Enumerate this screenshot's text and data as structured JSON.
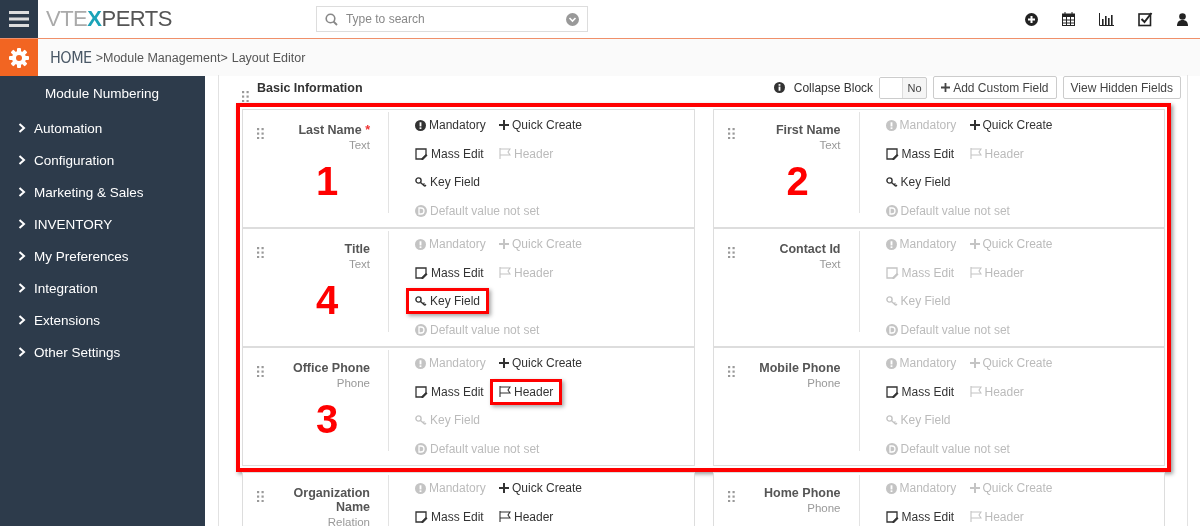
{
  "header": {
    "logo": {
      "lead": "VTE",
      "mark": "X",
      "tail": "PERTS"
    },
    "search": {
      "placeholder": "Type to search"
    }
  },
  "breadcrumb": [
    {
      "label": "HOME",
      "kind": "home"
    },
    {
      "label": ">Module Management>",
      "kind": "link"
    },
    {
      "label": "Layout Editor",
      "kind": "current"
    }
  ],
  "sidebar": {
    "items": [
      {
        "label": "Module Numbering",
        "kind": "subitem"
      },
      {
        "label": "Automation",
        "kind": "group",
        "expanded": false
      },
      {
        "label": "Configuration",
        "kind": "group",
        "expanded": false
      },
      {
        "label": "Marketing & Sales",
        "kind": "group",
        "expanded": false
      },
      {
        "label": "INVENTORY",
        "kind": "group",
        "expanded": false
      },
      {
        "label": "My Preferences",
        "kind": "group",
        "expanded": false
      },
      {
        "label": "Integration",
        "kind": "group",
        "expanded": false
      },
      {
        "label": "Extensions",
        "kind": "group",
        "expanded": false
      },
      {
        "label": "Other Settings",
        "kind": "group",
        "expanded": false
      }
    ]
  },
  "block": {
    "title": "Basic Information",
    "collapse_label": "Collapse Block",
    "collapse_toggle": {
      "on": false,
      "label": "No"
    },
    "buttons": [
      {
        "label": "Add Custom Field",
        "kind": "add"
      },
      {
        "label": "View Hidden Fields",
        "kind": "plain"
      }
    ],
    "rows": [
      {
        "outlined": true,
        "fields": [
          {
            "name": "Last Name",
            "required_mark": "*",
            "type": "Text",
            "marker": "1",
            "options": [
              {
                "kind": "mandatory",
                "label": "Mandatory",
                "active": true,
                "highlighted": false
              },
              {
                "kind": "quick_create",
                "label": "Quick Create",
                "active": true,
                "highlighted": false
              },
              {
                "kind": "mass_edit",
                "label": "Mass Edit",
                "active": true,
                "highlighted": false
              },
              {
                "kind": "header",
                "label": "Header",
                "active": false,
                "highlighted": false
              },
              {
                "kind": "key_field",
                "label": "Key Field",
                "active": true,
                "highlighted": false
              },
              {
                "kind": "default_value",
                "label": "Default value not set",
                "active": false,
                "highlighted": false
              }
            ]
          },
          {
            "name": "First Name",
            "type": "Text",
            "marker": "2",
            "options": [
              {
                "kind": "mandatory",
                "label": "Mandatory",
                "active": false,
                "highlighted": false
              },
              {
                "kind": "quick_create",
                "label": "Quick Create",
                "active": true,
                "highlighted": false
              },
              {
                "kind": "mass_edit",
                "label": "Mass Edit",
                "active": true,
                "highlighted": false
              },
              {
                "kind": "header",
                "label": "Header",
                "active": false,
                "highlighted": false
              },
              {
                "kind": "key_field",
                "label": "Key Field",
                "active": true,
                "highlighted": false
              },
              {
                "kind": "default_value",
                "label": "Default value not set",
                "active": false,
                "highlighted": false
              }
            ]
          }
        ]
      },
      {
        "outlined": true,
        "fields": [
          {
            "name": "Title",
            "type": "Text",
            "marker": "4",
            "options": [
              {
                "kind": "mandatory",
                "label": "Mandatory",
                "active": false,
                "highlighted": false
              },
              {
                "kind": "quick_create",
                "label": "Quick Create",
                "active": false,
                "highlighted": false
              },
              {
                "kind": "mass_edit",
                "label": "Mass Edit",
                "active": true,
                "highlighted": false
              },
              {
                "kind": "header",
                "label": "Header",
                "active": false,
                "highlighted": false
              },
              {
                "kind": "key_field",
                "label": "Key Field",
                "active": true,
                "highlighted": true
              },
              {
                "kind": "default_value",
                "label": "Default value not set",
                "active": false,
                "highlighted": false
              }
            ]
          },
          {
            "name": "Contact Id",
            "type": "Text",
            "options": [
              {
                "kind": "mandatory",
                "label": "Mandatory",
                "active": false,
                "highlighted": false
              },
              {
                "kind": "quick_create",
                "label": "Quick Create",
                "active": false,
                "highlighted": false
              },
              {
                "kind": "mass_edit",
                "label": "Mass Edit",
                "active": false,
                "highlighted": false
              },
              {
                "kind": "header",
                "label": "Header",
                "active": false,
                "highlighted": false
              },
              {
                "kind": "key_field",
                "label": "Key Field",
                "active": false,
                "highlighted": false
              },
              {
                "kind": "default_value",
                "label": "Default value not set",
                "active": false,
                "highlighted": false
              }
            ]
          }
        ]
      },
      {
        "outlined": true,
        "fields": [
          {
            "name": "Office Phone",
            "type": "Phone",
            "marker": "3",
            "options": [
              {
                "kind": "mandatory",
                "label": "Mandatory",
                "active": false,
                "highlighted": false
              },
              {
                "kind": "quick_create",
                "label": "Quick Create",
                "active": true,
                "highlighted": false
              },
              {
                "kind": "mass_edit",
                "label": "Mass Edit",
                "active": true,
                "highlighted": false
              },
              {
                "kind": "header",
                "label": "Header",
                "active": true,
                "highlighted": true
              },
              {
                "kind": "key_field",
                "label": "Key Field",
                "active": false,
                "highlighted": false
              },
              {
                "kind": "default_value",
                "label": "Default value not set",
                "active": false,
                "highlighted": false
              }
            ]
          },
          {
            "name": "Mobile Phone",
            "type": "Phone",
            "options": [
              {
                "kind": "mandatory",
                "label": "Mandatory",
                "active": false,
                "highlighted": false
              },
              {
                "kind": "quick_create",
                "label": "Quick Create",
                "active": false,
                "highlighted": false
              },
              {
                "kind": "mass_edit",
                "label": "Mass Edit",
                "active": true,
                "highlighted": false
              },
              {
                "kind": "header",
                "label": "Header",
                "active": false,
                "highlighted": false
              },
              {
                "kind": "key_field",
                "label": "Key Field",
                "active": false,
                "highlighted": false
              },
              {
                "kind": "default_value",
                "label": "Default value not set",
                "active": false,
                "highlighted": false
              }
            ]
          }
        ]
      },
      {
        "outlined": false,
        "fields": [
          {
            "name": "Organization Name",
            "type": "Relation",
            "options": [
              {
                "kind": "mandatory",
                "label": "Mandatory",
                "active": false,
                "highlighted": false
              },
              {
                "kind": "quick_create",
                "label": "Quick Create",
                "active": true,
                "highlighted": false
              },
              {
                "kind": "mass_edit",
                "label": "Mass Edit",
                "active": true,
                "highlighted": false
              },
              {
                "kind": "header",
                "label": "Header",
                "active": true,
                "highlighted": false
              }
            ]
          },
          {
            "name": "Home Phone",
            "type": "Phone",
            "options": [
              {
                "kind": "mandatory",
                "label": "Mandatory",
                "active": false,
                "highlighted": false
              },
              {
                "kind": "quick_create",
                "label": "Quick Create",
                "active": false,
                "highlighted": false
              },
              {
                "kind": "mass_edit",
                "label": "Mass Edit",
                "active": true,
                "highlighted": false
              },
              {
                "kind": "header",
                "label": "Header",
                "active": false,
                "highlighted": false
              }
            ]
          }
        ]
      }
    ]
  }
}
